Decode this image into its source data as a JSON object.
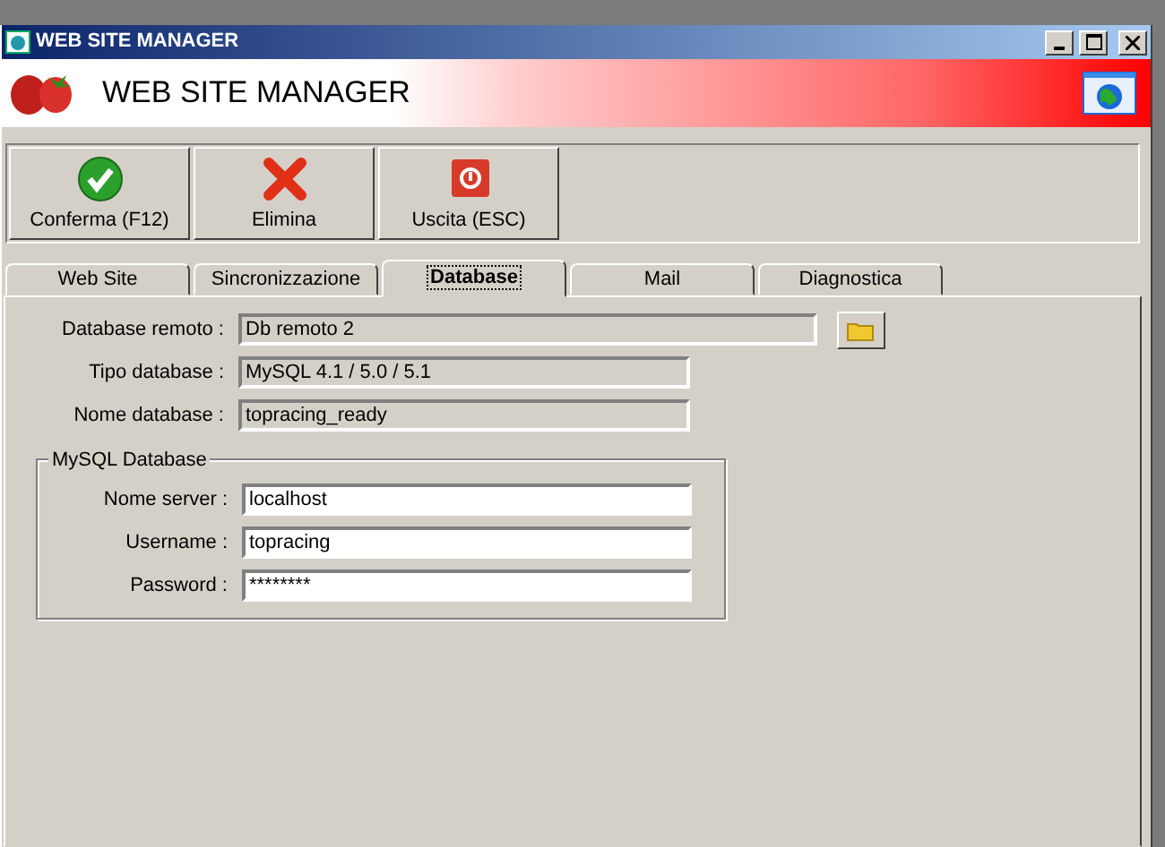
{
  "window": {
    "title": "WEB SITE MANAGER"
  },
  "header": {
    "title": "WEB SITE MANAGER"
  },
  "toolbar": [
    {
      "kind": "confirm",
      "label": "Conferma (F12)"
    },
    {
      "kind": "delete",
      "label": "Elimina"
    },
    {
      "kind": "exit",
      "label": "Uscita (ESC)"
    }
  ],
  "tabs": [
    {
      "label": "Web Site",
      "selected": false
    },
    {
      "label": "Sincronizzazione",
      "selected": false
    },
    {
      "label": "Database",
      "selected": true
    },
    {
      "label": "Mail",
      "selected": false
    },
    {
      "label": "Diagnostica",
      "selected": false
    }
  ],
  "fields": [
    {
      "label": "Database remoto :",
      "value": "Db remoto 2",
      "disabled": true,
      "browse": true
    },
    {
      "label": "Tipo database :",
      "value": "MySQL 4.1 / 5.0 / 5.1",
      "disabled": true
    },
    {
      "label": "Nome database :",
      "value": "topracing_ready",
      "disabled": true
    }
  ],
  "mysql_group": {
    "title": "MySQL Database",
    "fields": [
      {
        "label": "Nome server :",
        "value": "localhost",
        "disabled": false
      },
      {
        "label": "Username :",
        "value": "topracing",
        "disabled": false
      },
      {
        "label": "Password :",
        "value": "********",
        "disabled": false
      }
    ]
  }
}
